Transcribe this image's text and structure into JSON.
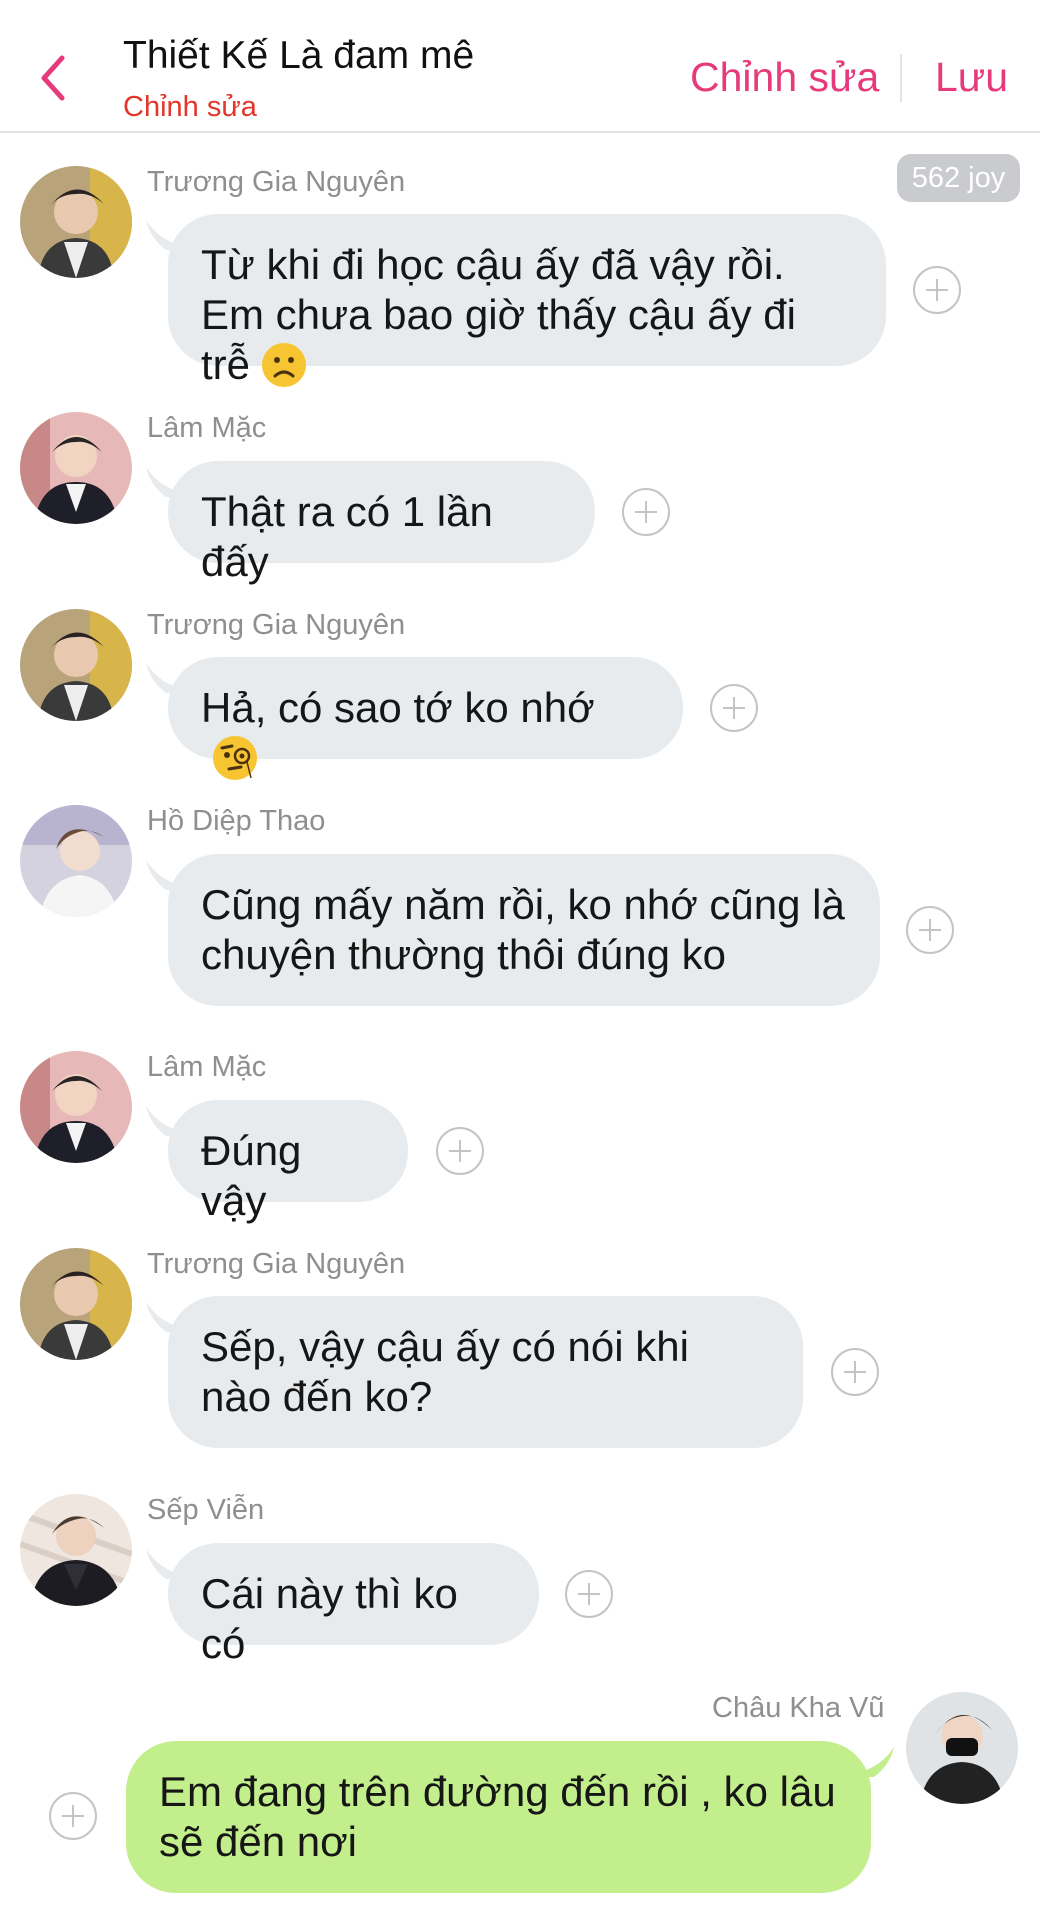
{
  "header": {
    "title": "Thiết Kế Là đam mê",
    "subtitle": "Chỉnh sửa",
    "edit_label": "Chỉnh sửa",
    "save_label": "Lưu"
  },
  "joy_badge": "562 joy",
  "colors": {
    "accent": "#e63a7a",
    "subtitle": "#e2362a",
    "bubble_other": "#e8ebee",
    "bubble_mine": "#c3ee8c"
  },
  "messages": [
    {
      "sender": "Trương Gia Nguyên",
      "text": "Từ khi đi học cậu ấy đã vậy rồi. Em chưa bao giờ thấy cậu ấy đi trễ",
      "emoji": "slightly-frowning-face-icon"
    },
    {
      "sender": "Lâm Mặc",
      "text": "Thật ra có 1 lần đấy"
    },
    {
      "sender": "Trương Gia Nguyên",
      "text": "Hả, có sao tớ ko nhớ",
      "emoji": "face-with-monocle-icon"
    },
    {
      "sender": "Hồ Diệp Thao",
      "text": "Cũng mấy năm rồi, ko nhớ cũng là chuyện thường thôi đúng ko"
    },
    {
      "sender": "Lâm Mặc",
      "text": "Đúng vậy"
    },
    {
      "sender": "Trương Gia Nguyên",
      "text": "Sếp, vậy cậu ấy có nói khi nào đến ko?"
    },
    {
      "sender": "Sếp Viễn",
      "text": "Cái này thì ko có"
    },
    {
      "sender": "Châu Kha Vũ",
      "text": "Em đang trên đường đến rồi , ko lâu sẽ đến nơi",
      "mine": true
    }
  ]
}
